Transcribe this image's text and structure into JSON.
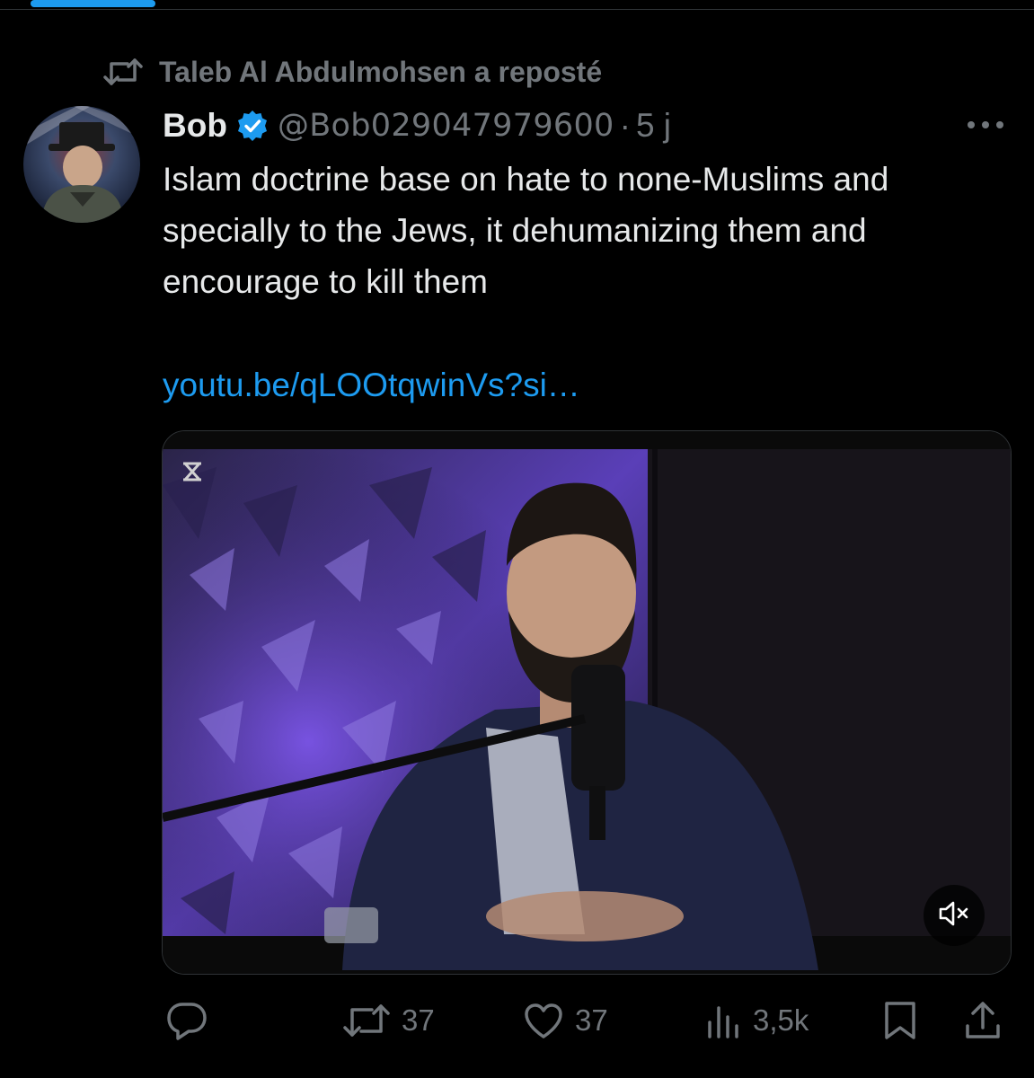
{
  "repost": {
    "label": "Taleb Al Abdulmohsen a reposté",
    "icon": "repost-icon"
  },
  "tweet": {
    "author": {
      "display_name": "Bob",
      "handle": "@Bob029047979600",
      "verified": true,
      "verified_color": "#1d9bf0"
    },
    "separator": "·",
    "time": "5 j",
    "text": "Islam doctrine base on hate to none-Muslims and specially to the Jews, it dehumanizing them and encourage to kill them",
    "link": "youtu.be/qLOOtqwinVs?si…",
    "media": {
      "type": "video",
      "muted": true
    },
    "actions": {
      "reply": {
        "icon": "reply-icon",
        "count": ""
      },
      "repost": {
        "icon": "repost-icon",
        "count": "37"
      },
      "like": {
        "icon": "heart-icon",
        "count": "37"
      },
      "views": {
        "icon": "views-icon",
        "count": "3,5k"
      },
      "bookmark": {
        "icon": "bookmark-icon"
      },
      "share": {
        "icon": "share-icon"
      }
    }
  },
  "colors": {
    "background": "#000000",
    "text_primary": "#e7e9ea",
    "text_secondary": "#71767b",
    "accent": "#1d9bf0",
    "border": "#2f3336"
  }
}
